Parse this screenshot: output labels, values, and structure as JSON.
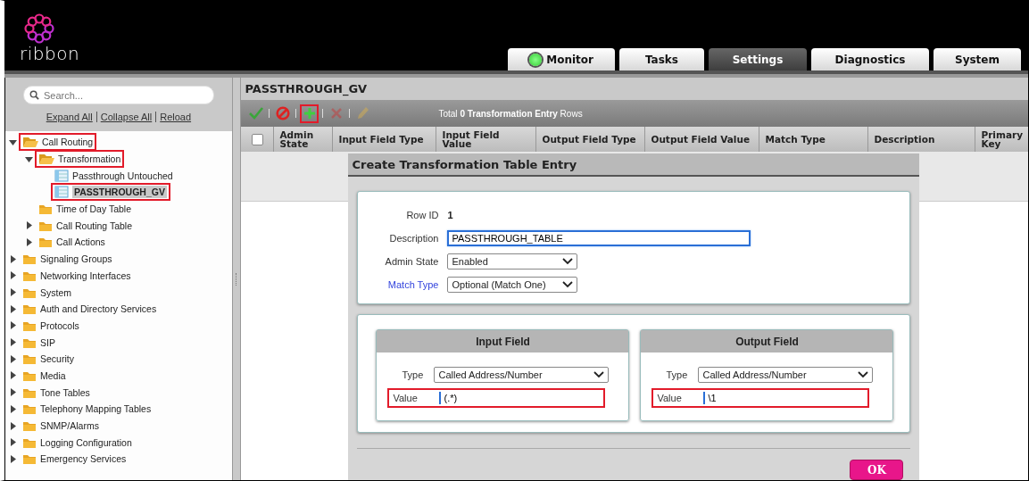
{
  "logo": {
    "text": "ribbon"
  },
  "tabs": [
    {
      "label": "Monitor",
      "selected": false,
      "status_light": true
    },
    {
      "label": "Tasks",
      "selected": false,
      "status_light": false
    },
    {
      "label": "Settings",
      "selected": true,
      "status_light": false
    },
    {
      "label": "Diagnostics",
      "selected": false,
      "status_light": false
    },
    {
      "label": "System",
      "selected": false,
      "status_light": false
    }
  ],
  "sidebar": {
    "search": {
      "placeholder": "Search..."
    },
    "links": [
      "Expand All",
      "Collapse All",
      "Reload"
    ],
    "tree": [
      {
        "label": "Call Routing",
        "kind": "folder",
        "expanded": true,
        "selected": false,
        "highlighted": true,
        "children": [
          {
            "label": "Transformation",
            "kind": "folder",
            "expanded": true,
            "selected": false,
            "highlighted": true,
            "children": [
              {
                "label": "Passthrough Untouched",
                "kind": "table",
                "selected": false,
                "highlighted": false
              },
              {
                "label": "PASSTHROUGH_GV",
                "kind": "table",
                "selected": true,
                "highlighted": true
              }
            ]
          },
          {
            "label": "Time of Day Table",
            "kind": "leaf-folder",
            "selected": false,
            "highlighted": false
          },
          {
            "label": "Call Routing Table",
            "kind": "folder",
            "expanded": false,
            "selected": false,
            "highlighted": false
          },
          {
            "label": "Call Actions",
            "kind": "folder",
            "expanded": false,
            "selected": false,
            "highlighted": false
          }
        ]
      },
      {
        "label": "Signaling Groups",
        "kind": "folder",
        "expanded": false,
        "selected": false,
        "highlighted": false
      },
      {
        "label": "Networking Interfaces",
        "kind": "folder",
        "expanded": false,
        "selected": false,
        "highlighted": false
      },
      {
        "label": "System",
        "kind": "folder",
        "expanded": false,
        "selected": false,
        "highlighted": false
      },
      {
        "label": "Auth and Directory Services",
        "kind": "folder",
        "expanded": false,
        "selected": false,
        "highlighted": false
      },
      {
        "label": "Protocols",
        "kind": "folder",
        "expanded": false,
        "selected": false,
        "highlighted": false
      },
      {
        "label": "SIP",
        "kind": "folder",
        "expanded": false,
        "selected": false,
        "highlighted": false
      },
      {
        "label": "Security",
        "kind": "folder",
        "expanded": false,
        "selected": false,
        "highlighted": false
      },
      {
        "label": "Media",
        "kind": "folder",
        "expanded": false,
        "selected": false,
        "highlighted": false
      },
      {
        "label": "Tone Tables",
        "kind": "folder",
        "expanded": false,
        "selected": false,
        "highlighted": false
      },
      {
        "label": "Telephony Mapping Tables",
        "kind": "folder",
        "expanded": false,
        "selected": false,
        "highlighted": false
      },
      {
        "label": "SNMP/Alarms",
        "kind": "folder",
        "expanded": false,
        "selected": false,
        "highlighted": false
      },
      {
        "label": "Logging Configuration",
        "kind": "folder",
        "expanded": false,
        "selected": false,
        "highlighted": false
      },
      {
        "label": "Emergency Services",
        "kind": "folder",
        "expanded": false,
        "selected": false,
        "highlighted": false
      }
    ]
  },
  "page": {
    "title": "PASSTHROUGH_GV",
    "toolbar": [
      {
        "kind": "apply",
        "disabled": false,
        "highlighted": false
      },
      {
        "kind": "cancel",
        "disabled": false,
        "highlighted": false
      },
      {
        "kind": "add",
        "disabled": false,
        "highlighted": true
      },
      {
        "kind": "delete",
        "disabled": true,
        "highlighted": false
      },
      {
        "kind": "edit",
        "disabled": true,
        "highlighted": false
      }
    ],
    "total": "Total **0 Transformation Entry** Rows",
    "table": {
      "select_all": {
        "checked": false
      },
      "columns": [
        "Admin State",
        "Input Field Type",
        "Input Field Value",
        "Output Field Type",
        "Output Field Value",
        "Match Type",
        "Description",
        "Primary Key"
      ]
    }
  },
  "dialog": {
    "title": "Create Transformation Table Entry",
    "fields": [
      {
        "label": "Row ID",
        "kind": "text",
        "value": "1",
        "link": false,
        "highlighted": false
      },
      {
        "label": "Description",
        "kind": "input",
        "value": "PASSTHROUGH_TABLE",
        "link": false,
        "focused": true,
        "highlighted": false
      },
      {
        "label": "Admin State",
        "kind": "select",
        "value": "Enabled",
        "link": false,
        "highlighted": false
      },
      {
        "label": "Match Type",
        "kind": "select",
        "value": "Optional (Match One)",
        "link": true,
        "highlighted": false
      }
    ],
    "panels": [
      {
        "title": "Input Field",
        "fields": [
          {
            "label": "Type",
            "kind": "select",
            "value": "Called Address/Number",
            "link": false,
            "highlighted": false
          },
          {
            "label": "Value",
            "kind": "input",
            "value": "(.*)",
            "link": false,
            "highlighted": true
          }
        ]
      },
      {
        "title": "Output Field",
        "fields": [
          {
            "label": "Type",
            "kind": "select",
            "value": "Called Address/Number",
            "link": false,
            "highlighted": false
          },
          {
            "label": "Value",
            "kind": "input",
            "value": "\\1",
            "link": false,
            "highlighted": true
          }
        ]
      }
    ],
    "ok_button": "OK"
  }
}
